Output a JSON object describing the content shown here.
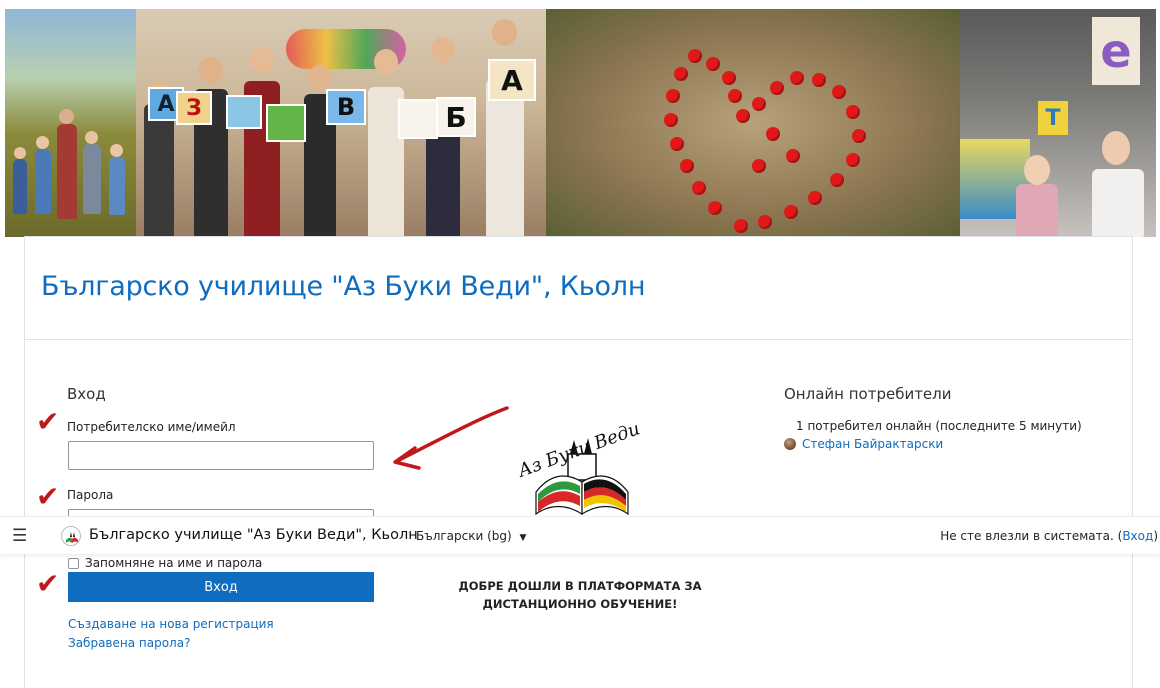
{
  "site": {
    "name": "Българско училище \"Аз Буки Веди\", Кьолн",
    "heading": "Българско училище \"Аз Буки Веди\", Кьолн"
  },
  "banner": {
    "letters": [
      "А",
      "З",
      "В",
      "Б",
      "А",
      "Т",
      "е"
    ]
  },
  "navbar": {
    "language": "Български (bg)",
    "not_logged_in": "Не сте влезли в системата.",
    "login_link": "Вход",
    "open_paren": "(",
    "close_paren": ")"
  },
  "login": {
    "heading": "Вход",
    "username_label": "Потребителско име/имейл",
    "password_label": "Парола",
    "remember_label": "Запомняне на име и парола",
    "button_label": "Вход",
    "signup_link": "Създаване на нова регистрация",
    "forgot_link": "Забравена парола?"
  },
  "logo": {
    "text": "Аз Буки Веди"
  },
  "welcome": {
    "line1": "ДОБРЕ ДОШЛИ В ПЛАТФОРМАТА ЗА",
    "line2": "ДИСТАНЦИОННО ОБУЧЕНИЕ!"
  },
  "online": {
    "heading": "Онлайн потребители",
    "count_text": "1 потребител онлайн (последните 5 минути)",
    "users": [
      {
        "name": "Стефан Байрактарски"
      }
    ]
  },
  "colors": {
    "link": "#0f6cbf",
    "checkmark": "#c0191b"
  }
}
